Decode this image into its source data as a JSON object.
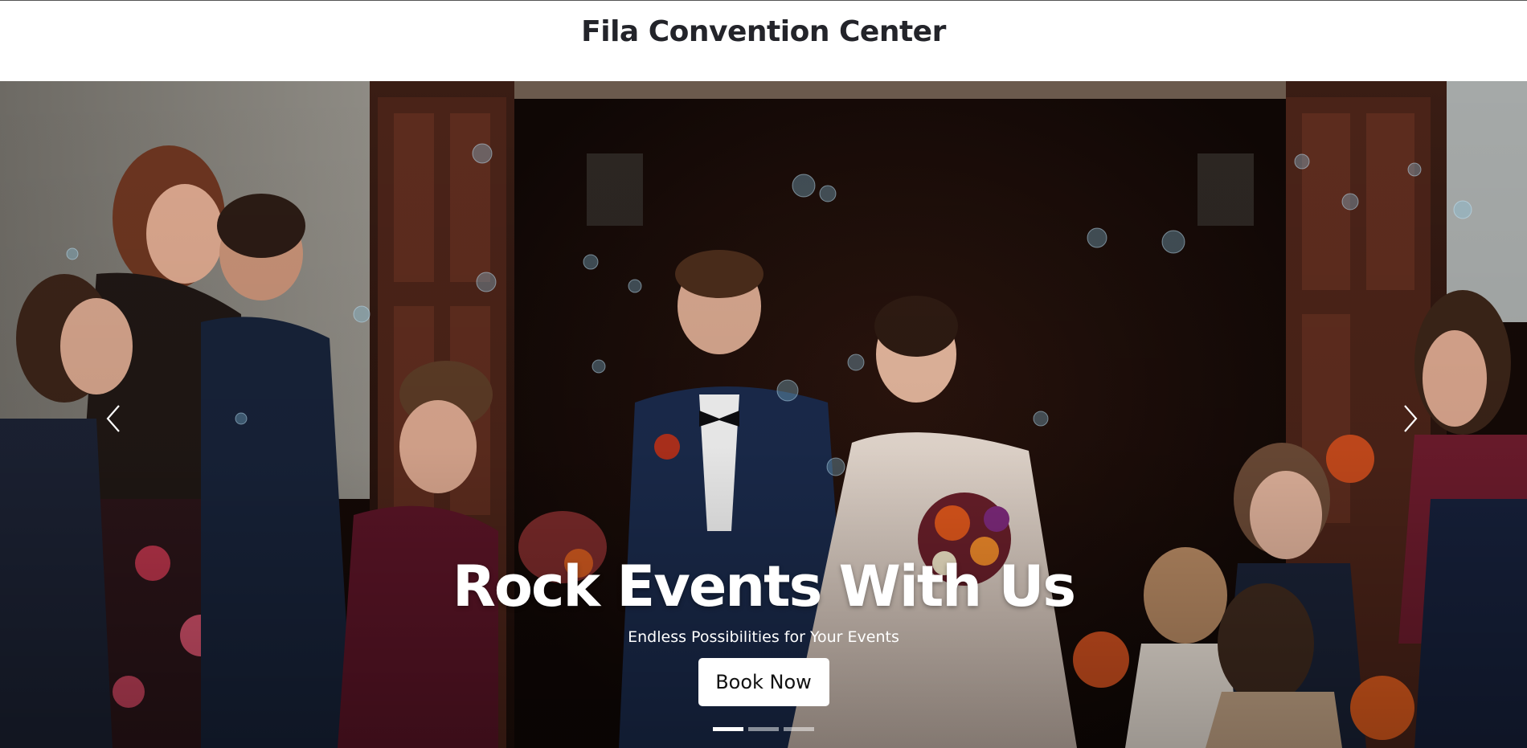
{
  "header": {
    "site_title": "Fila Convention Center"
  },
  "hero": {
    "heading": "Rock Events With Us",
    "subheading": "Endless Possibilities for Your Events",
    "cta_label": "Book Now",
    "prev_icon": "chevron-left-icon",
    "next_icon": "chevron-right-icon",
    "slides_total": 3,
    "active_slide": 1
  },
  "colors": {
    "title_text": "#23242a",
    "hero_text": "#ffffff",
    "button_bg": "#ffffff"
  }
}
